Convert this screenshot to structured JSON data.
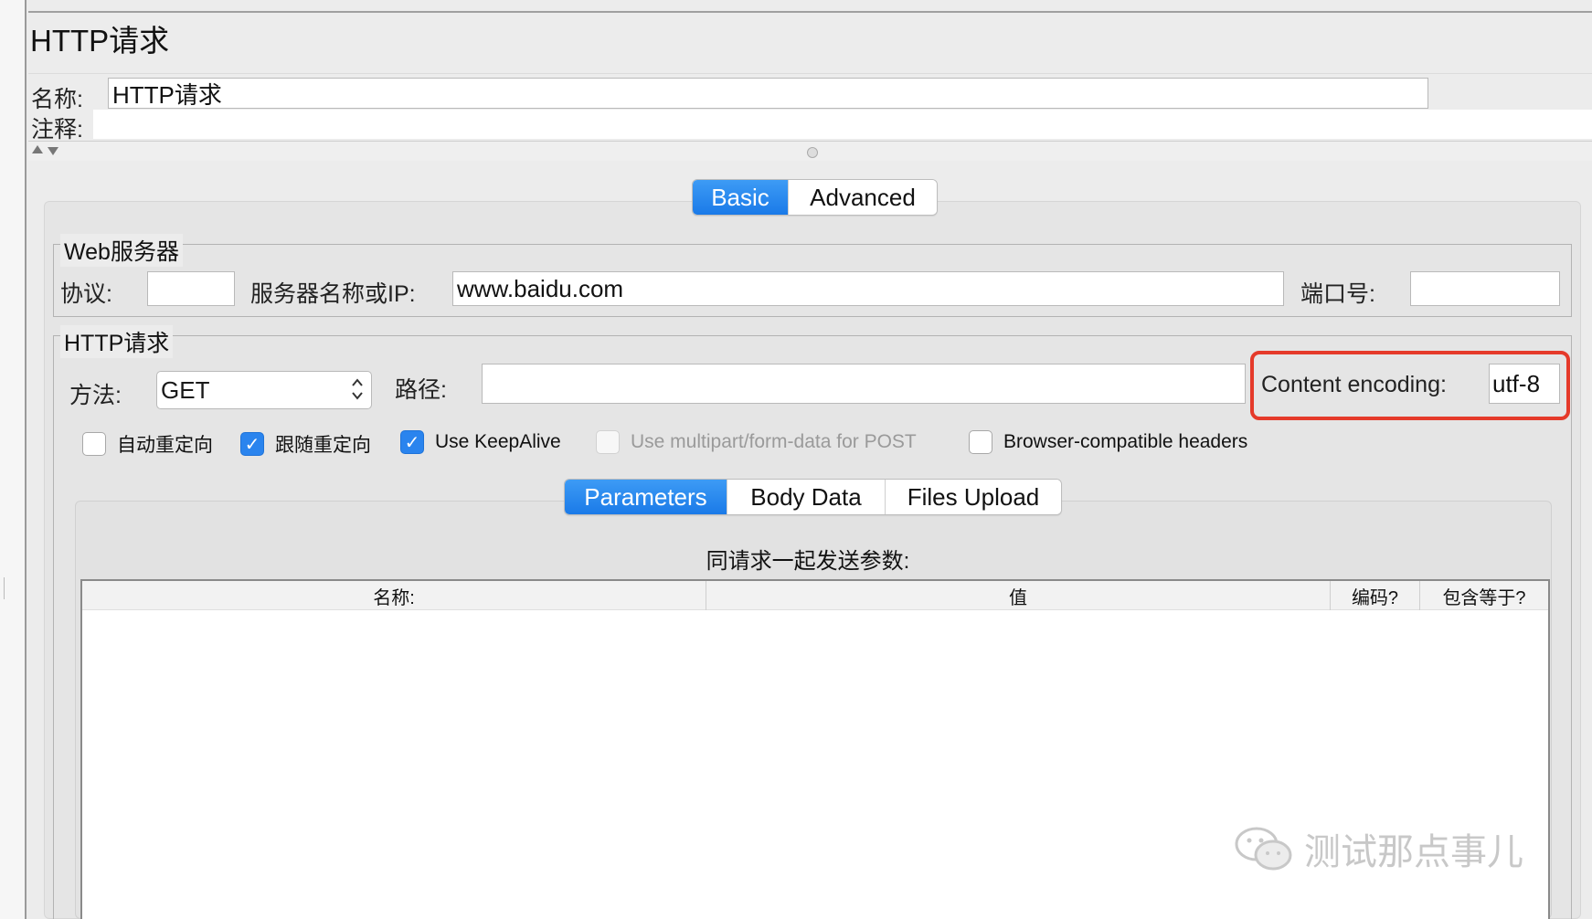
{
  "panel": {
    "title": "HTTP请求"
  },
  "name_field": {
    "label": "名称:",
    "value": "HTTP请求"
  },
  "comment_field": {
    "label": "注释:",
    "value": ""
  },
  "config_tabs": [
    {
      "label": "Basic",
      "active": true
    },
    {
      "label": "Advanced",
      "active": false
    }
  ],
  "web_server": {
    "legend": "Web服务器",
    "protocol_label": "协议:",
    "protocol_value": "",
    "server_label": "服务器名称或IP:",
    "server_value": "www.baidu.com",
    "port_label": "端口号:",
    "port_value": ""
  },
  "http_request": {
    "legend": "HTTP请求",
    "method_label": "方法:",
    "method_value": "GET",
    "path_label": "路径:",
    "path_value": "",
    "encoding_label": "Content encoding:",
    "encoding_value": "utf-8"
  },
  "checkboxes": [
    {
      "label": "自动重定向",
      "checked": false,
      "disabled": false
    },
    {
      "label": "跟随重定向",
      "checked": true,
      "disabled": false
    },
    {
      "label": "Use KeepAlive",
      "checked": true,
      "disabled": false
    },
    {
      "label": "Use multipart/form-data for POST",
      "checked": false,
      "disabled": true
    },
    {
      "label": "Browser-compatible headers",
      "checked": false,
      "disabled": false
    }
  ],
  "param_tabs": [
    {
      "label": "Parameters",
      "active": true
    },
    {
      "label": "Body Data",
      "active": false
    },
    {
      "label": "Files Upload",
      "active": false
    }
  ],
  "params_caption": "同请求一起发送参数:",
  "table_headers": [
    "名称:",
    "值",
    "编码?",
    "包含等于?"
  ],
  "watermark": "测试那点事儿",
  "colors": {
    "accent": "#1a7ae8",
    "highlight": "#e53a2a"
  }
}
